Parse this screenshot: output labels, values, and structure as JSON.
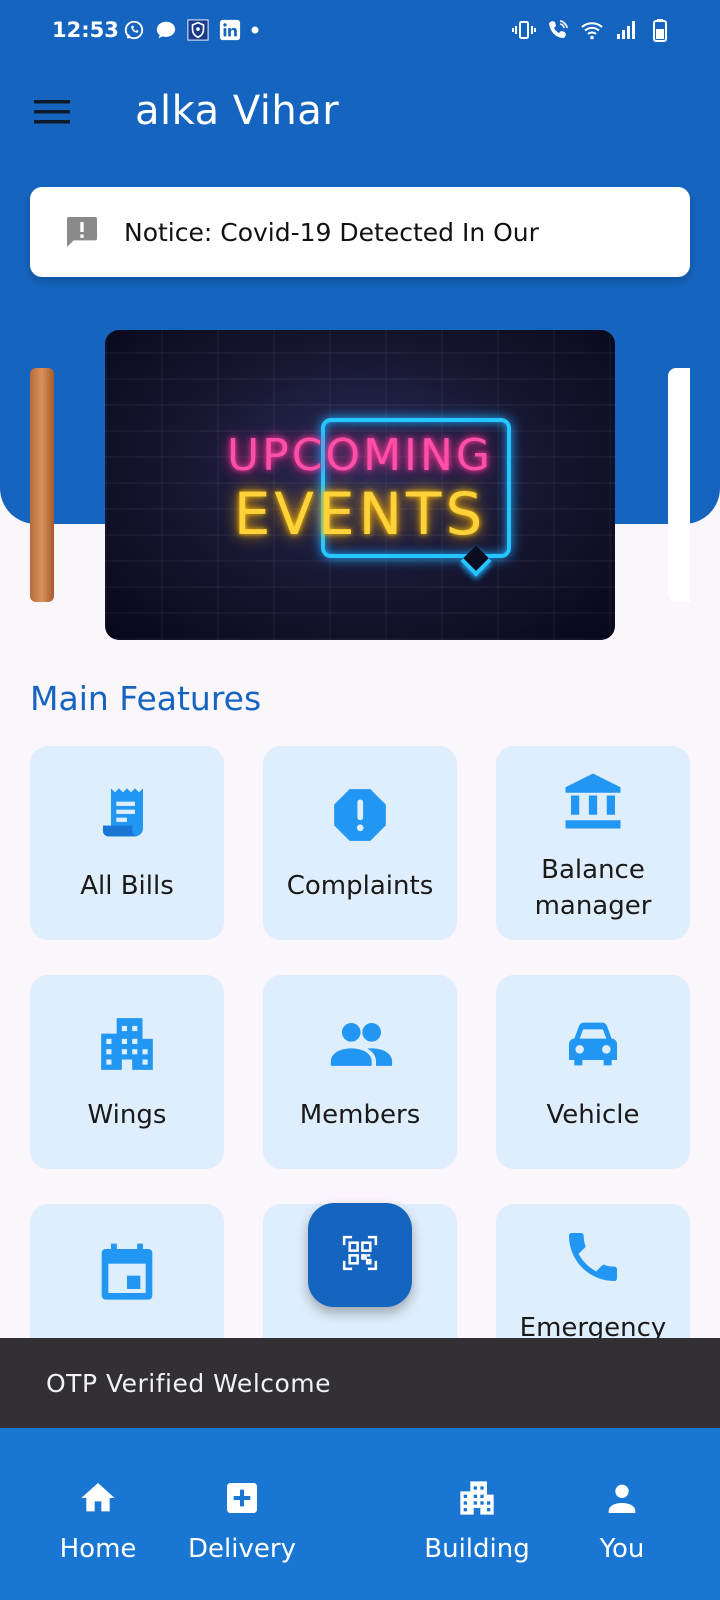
{
  "status_bar": {
    "time": "12:53",
    "left_icons": [
      "whatsapp-icon",
      "message-icon",
      "shield-app-icon",
      "linkedin-icon",
      "dot-icon"
    ],
    "right_icons": [
      "vibrate-icon",
      "wifi-call-icon",
      "wifi-icon",
      "signal-icon",
      "battery-icon"
    ]
  },
  "app_bar": {
    "title": "alka Vihar",
    "menu_icon": "hamburger-menu-icon"
  },
  "notice": {
    "icon": "feedback-alert-icon",
    "text": "Notice: Covid-19 Detected In Our"
  },
  "banner": {
    "line1": "UPCOMING",
    "line2": "EVENTS"
  },
  "main_features": {
    "title": "Main Features",
    "items": [
      {
        "label": "All Bills",
        "icon": "receipt-icon"
      },
      {
        "label": "Complaints",
        "icon": "report-octagon-icon"
      },
      {
        "label": "Balance manager",
        "icon": "bank-icon"
      },
      {
        "label": "Wings",
        "icon": "apartment-icon"
      },
      {
        "label": "Members",
        "icon": "people-icon"
      },
      {
        "label": "Vehicle",
        "icon": "car-icon"
      },
      {
        "label": "",
        "icon": "calendar-icon"
      },
      {
        "label": "",
        "icon": ""
      },
      {
        "label": "Emergency",
        "icon": "phone-icon"
      }
    ]
  },
  "fab": {
    "icon": "qr-scan-icon"
  },
  "snackbar": {
    "text": "OTP Verified Welcome"
  },
  "bottom_nav": {
    "items": [
      {
        "label": "Home",
        "icon": "home-icon"
      },
      {
        "label": "Delivery",
        "icon": "add-box-icon"
      },
      {
        "label": "Building",
        "icon": "building-icon"
      },
      {
        "label": "You",
        "icon": "person-icon"
      }
    ]
  },
  "colors": {
    "primary": "#1565c0",
    "nav": "#1976d2",
    "tile": "#dfeefc",
    "icon_blue": "#2196f3",
    "snackbar": "#323035"
  }
}
